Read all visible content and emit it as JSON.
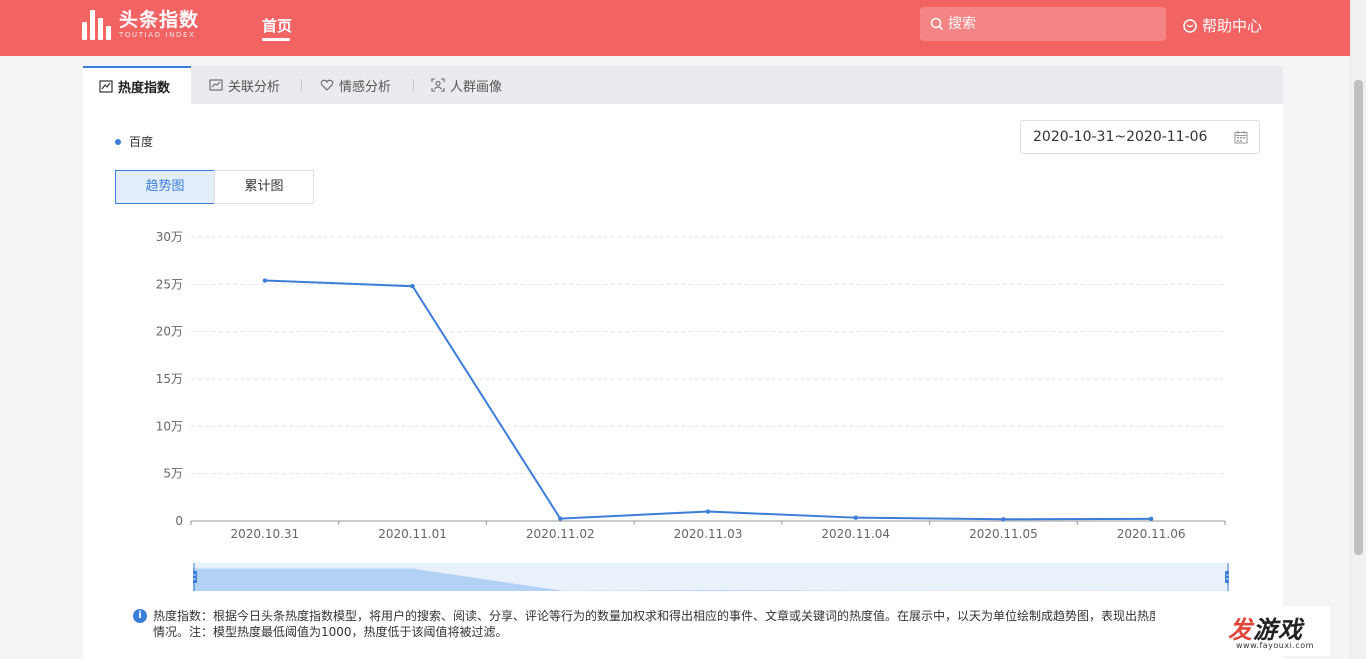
{
  "header": {
    "logo_cn": "头条指数",
    "logo_en": "TOUTIAO INDEX",
    "nav_home": "首页",
    "search_placeholder": "搜索",
    "help_label": "帮助中心",
    "accent_color": "#f26363"
  },
  "tabs": [
    {
      "label": "热度指数",
      "icon": "trend-chart-icon",
      "active": true
    },
    {
      "label": "关联分析",
      "icon": "relation-chart-icon",
      "active": false
    },
    {
      "label": "情感分析",
      "icon": "heart-icon",
      "active": false
    },
    {
      "label": "人群画像",
      "icon": "user-scan-icon",
      "active": false
    }
  ],
  "legend": {
    "series_name": "百度"
  },
  "date_range": {
    "value": "2020-10-31~2020-11-06"
  },
  "view_toggle": {
    "trend_label": "趋势图",
    "cumulative_label": "累计图",
    "selected": "趋势图"
  },
  "chart_data": {
    "type": "line",
    "title": "",
    "xlabel": "",
    "ylabel": "",
    "categories": [
      "2020.10.31",
      "2020.11.01",
      "2020.11.02",
      "2020.11.03",
      "2020.11.04",
      "2020.11.05",
      "2020.11.06"
    ],
    "series": [
      {
        "name": "百度",
        "color": "#3b7dd8",
        "values": [
          254000,
          248000,
          2500,
          10000,
          3500,
          1800,
          2300
        ]
      }
    ],
    "ylim": [
      0,
      300000
    ],
    "yticks": [
      0,
      50000,
      100000,
      150000,
      200000,
      250000,
      300000
    ],
    "ytick_labels": [
      "0",
      "5万",
      "10万",
      "15万",
      "20万",
      "25万",
      "30万"
    ],
    "grid": true,
    "grid_style": "dashed",
    "legend_placement": "top-left"
  },
  "note": {
    "text": "热度指数：根据今日头条热度指数模型，将用户的搜索、阅读、分享、评论等行为的数量加权求和得出相应的事件、文章或关键词的热度值。在展示中，以天为单位绘制成趋势图，表现出热度",
    "text2": "情况。注：模型热度最低阈值为1000，热度低于该阈值将被过滤。"
  },
  "watermark": {
    "main_a": "发",
    "main_b": "游戏",
    "url": "www.fayouxi.com"
  }
}
